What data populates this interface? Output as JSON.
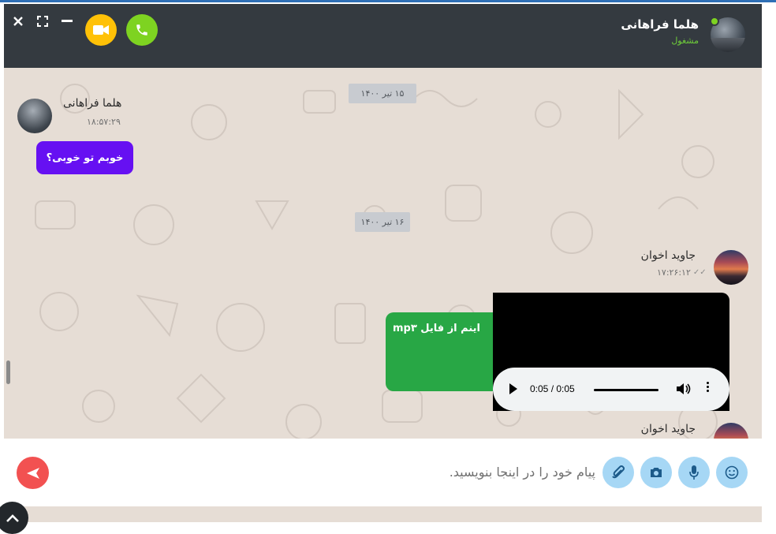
{
  "header": {
    "contact_name": "هلما فراهانی",
    "contact_status": "مشغول",
    "call_icon": "phone-icon",
    "video_icon": "video-camera-icon",
    "window_controls": [
      "close-icon",
      "expand-icon",
      "minimize-icon"
    ]
  },
  "messages": {
    "date_1": "۱۵ تیر ۱۴۰۰",
    "date_2": "۱۶ تیر ۱۴۰۰",
    "helma": {
      "sender": "هلما فراهانی",
      "time": "۱۸:۵۷:۲۹",
      "text": "خوبم تو خوبی؟"
    },
    "javid": {
      "sender": "جاوید اخوان",
      "time": "۱۷:۲۶:۱۲",
      "text": "اینم از فایل mp۳",
      "audio_time": "0:05 / 0:05"
    },
    "javid_next": {
      "sender": "جاوید اخوان"
    }
  },
  "composer": {
    "placeholder": "پیام خود را در اینجا بنویسید.",
    "tools": [
      "smile-icon",
      "microphone-icon",
      "camera-icon",
      "paperclip-icon"
    ],
    "send_icon": "send-icon"
  },
  "colors": {
    "header_bg": "#343a40",
    "chat_bg": "#e6ddd5",
    "online": "#7ed321",
    "call": "#7ed321",
    "video": "#ffc107",
    "purple_bubble": "#6610f2",
    "green_bubble": "#28a745",
    "tool_button": "#a6d7f5",
    "send_button": "#f25151"
  }
}
